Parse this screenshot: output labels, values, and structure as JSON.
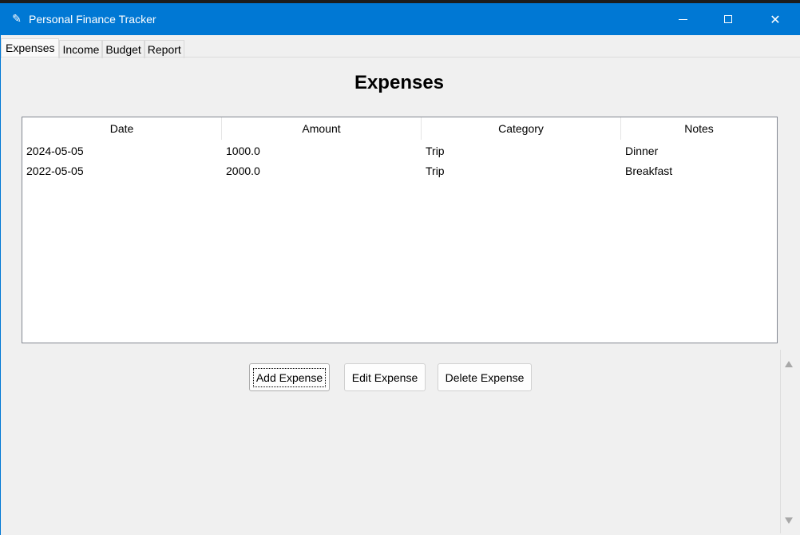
{
  "window": {
    "title": "Personal Finance Tracker",
    "icon": "feather-icon",
    "accent": "#0078d4",
    "controls": {
      "minimize": "minimize-icon",
      "maximize": "maximize-icon",
      "close": "✕"
    }
  },
  "tabs": [
    {
      "label": "Expenses",
      "active": true
    },
    {
      "label": "Income",
      "active": false
    },
    {
      "label": "Budget",
      "active": false
    },
    {
      "label": "Report",
      "active": false
    }
  ],
  "main": {
    "heading": "Expenses",
    "table": {
      "columns": [
        "Date",
        "Amount",
        "Category",
        "Notes"
      ],
      "rows": [
        [
          "2024-05-05",
          "1000.0",
          "Trip",
          "Dinner"
        ],
        [
          "2022-05-05",
          "2000.0",
          "Trip",
          "Breakfast"
        ]
      ]
    },
    "buttons": {
      "add": "Add Expense",
      "edit": "Edit Expense",
      "delete": "Delete Expense"
    }
  }
}
